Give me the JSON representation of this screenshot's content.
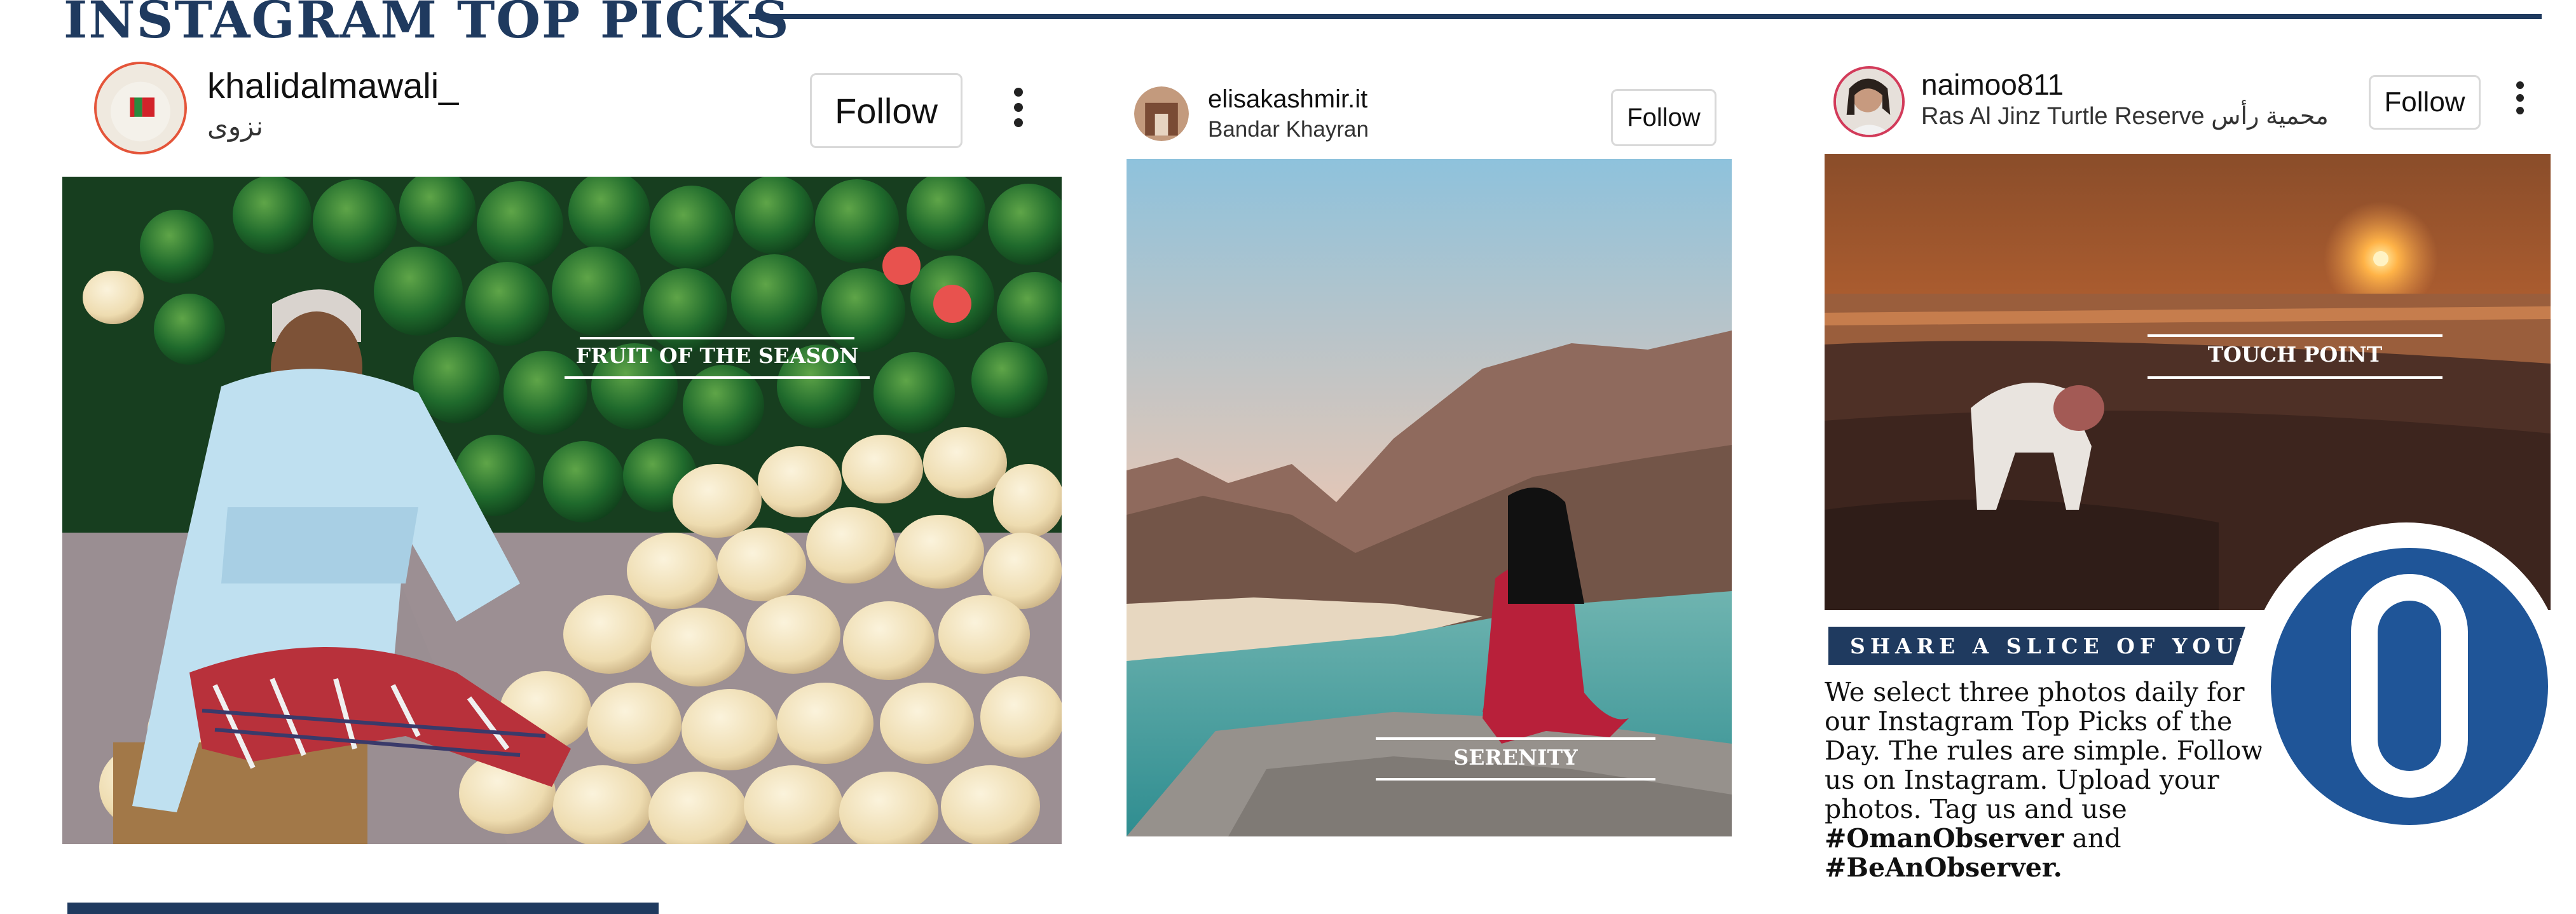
{
  "header": {
    "title": "INSTAGRAM TOP PICKS"
  },
  "posts": [
    {
      "username": "khalidalmawali_",
      "location": "نزوى",
      "follow_label": "Follow",
      "caption": "FRUIT OF THE SEASON"
    },
    {
      "username": "elisakashmir.it",
      "location": "Bandar Khayran",
      "follow_label": "Follow",
      "caption": "SERENITY"
    },
    {
      "username": "naimoo811",
      "location": "Ras Al Jinz Turtle Reserve محمية رأس",
      "follow_label": "Follow",
      "caption": "TOUCH POINT"
    }
  ],
  "share": {
    "banner": "SHARE A SLICE OF YOUR LIFE",
    "body": "We select three photos daily for our Instagram Top Picks of the Day. The rules are simple. Follow us on Instagram. Upload your photos. Tag us and use",
    "tag1": "#OmanObserver",
    "and": "and",
    "tag2": "#BeAnObserver."
  },
  "colors": {
    "brand_navy": "#1f3a5f",
    "logo_blue": "#1f5598",
    "follow_border": "#d9d9d9"
  },
  "icons": [
    "more-options-icon",
    "observer-logo"
  ]
}
